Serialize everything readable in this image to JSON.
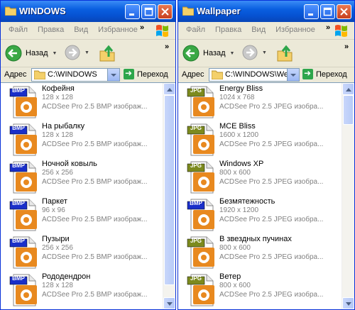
{
  "windows": [
    {
      "title": "WINDOWS",
      "menu": [
        "Файл",
        "Правка",
        "Вид",
        "Избранное"
      ],
      "menu_more": "»",
      "toolbar": {
        "back_label": "Назад",
        "more": "»"
      },
      "address": {
        "label": "Адрес",
        "path": "C:\\WINDOWS",
        "go_label": "Переход"
      },
      "files": [
        {
          "badge": "BMP",
          "name": "Кофейня",
          "dims": "128 x 128",
          "type": "ACDSee Pro 2.5 BMP изображ..."
        },
        {
          "badge": "BMP",
          "name": "На рыбалку",
          "dims": "128 x 128",
          "type": "ACDSee Pro 2.5 BMP изображ..."
        },
        {
          "badge": "BMP",
          "name": "Ночной ковыль",
          "dims": "256 x 256",
          "type": "ACDSee Pro 2.5 BMP изображ..."
        },
        {
          "badge": "BMP",
          "name": "Паркет",
          "dims": "96 x 96",
          "type": "ACDSee Pro 2.5 BMP изображ..."
        },
        {
          "badge": "BMP",
          "name": "Пузыри",
          "dims": "256 x 256",
          "type": "ACDSee Pro 2.5 BMP изображ..."
        },
        {
          "badge": "BMP",
          "name": "Рододендрон",
          "dims": "128 x 128",
          "type": "ACDSee Pro 2.5 BMP изображ..."
        }
      ]
    },
    {
      "title": "Wallpaper",
      "menu": [
        "Файл",
        "Правка",
        "Вид",
        "Избранное"
      ],
      "menu_more": "»",
      "toolbar": {
        "back_label": "Назад",
        "more": "»"
      },
      "address": {
        "label": "Адрес",
        "path": "C:\\WINDOWS\\We",
        "go_label": "Переход"
      },
      "files": [
        {
          "badge": "JPG",
          "name": "Energy Bliss",
          "dims": "1024 x 768",
          "type": "ACDSee Pro 2.5 JPEG изобра..."
        },
        {
          "badge": "JPG",
          "name": "MCE Bliss",
          "dims": "1600 x 1200",
          "type": "ACDSee Pro 2.5 JPEG изобра..."
        },
        {
          "badge": "JPG",
          "name": "Windows XP",
          "dims": "800 x 600",
          "type": "ACDSee Pro 2.5 JPEG изобра..."
        },
        {
          "badge": "BMP",
          "name": "Безмятежность",
          "dims": "1920 x 1200",
          "type": "ACDSee Pro 2.5 JPEG изобра..."
        },
        {
          "badge": "JPG",
          "name": "В звездных пучинах",
          "dims": "800 x 600",
          "type": "ACDSee Pro 2.5 JPEG изобра..."
        },
        {
          "badge": "JPG",
          "name": "Ветер",
          "dims": "800 x 600",
          "type": "ACDSee Pro 2.5 JPEG изобра..."
        }
      ]
    }
  ],
  "colors": {
    "bmp_badge": "#1a2fc9",
    "jpg_badge": "#7c8a1e",
    "icon_orange": "#e8891f",
    "titlebar": "#0a5fe0"
  }
}
